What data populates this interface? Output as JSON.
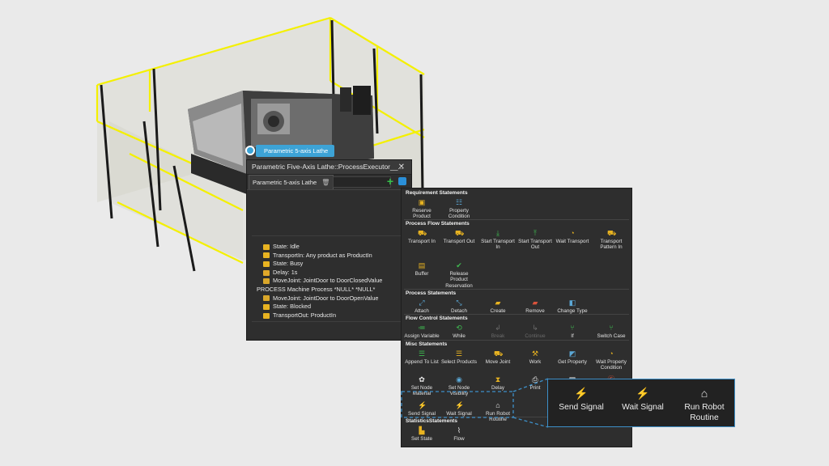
{
  "colors": {
    "accent": "#3d8fc8",
    "fence": "#f4f000",
    "panel_bg": "#2e2e2e",
    "green_plus": "#36c24b"
  },
  "scene": {
    "tooltip_label": "Parametric 5-axis Lathe"
  },
  "executor": {
    "title": "Parametric Five-Axis Lathe::ProcessExecutor__...",
    "close_glyph": "✕",
    "tab_label": "Parametric 5-axis Lathe",
    "add_glyph": "+",
    "statements": [
      {
        "text": "State: Idle",
        "icon": "chart-icon",
        "color": "#e8b321"
      },
      {
        "text": "TransportIn: Any product as ProductIn",
        "icon": "transport-in-icon",
        "color": "#e8b321"
      },
      {
        "text": "State: Busy",
        "icon": "chart-icon",
        "color": "#e8b321"
      },
      {
        "text": "Delay: 1s",
        "icon": "delay-icon",
        "color": "#e0a82a"
      },
      {
        "text": "MoveJoint: JointDoor to DoorClosedValue",
        "icon": "move-joint-icon",
        "color": "#d9a62a"
      },
      {
        "text": "PROCESS Machine Process *NULL* *NULL*",
        "icon": "",
        "color": ""
      },
      {
        "text": "MoveJoint: JointDoor to DoorOpenValue",
        "icon": "move-joint-icon",
        "color": "#d9a62a"
      },
      {
        "text": "State: Blocked",
        "icon": "chart-icon",
        "color": "#e8b321"
      },
      {
        "text": "TransportOut: ProductIn",
        "icon": "transport-out-icon",
        "color": "#e8b321"
      }
    ]
  },
  "palette": {
    "sections": [
      {
        "title": "Requirement Statements",
        "items": [
          {
            "label": "Reserve\nProduct",
            "icon": "reserve-product-icon",
            "glyph": "▣",
            "color": "#e8b321",
            "enabled": true
          },
          {
            "label": "Property\nCondition",
            "icon": "property-condition-icon",
            "glyph": "☷",
            "color": "#5ba8d6",
            "enabled": true
          }
        ]
      },
      {
        "title": "Process Flow Statements",
        "items": [
          {
            "label": "Transport In",
            "icon": "transport-in-icon",
            "glyph": "⛟",
            "color": "#e8b321",
            "enabled": true
          },
          {
            "label": "Transport Out",
            "icon": "transport-out-icon",
            "glyph": "⛟",
            "color": "#e8b321",
            "enabled": true
          },
          {
            "label": "Start Transport\nIn",
            "icon": "start-transport-in-icon",
            "glyph": "⤓",
            "color": "#3fb950",
            "enabled": true
          },
          {
            "label": "Start Transport\nOut",
            "icon": "start-transport-out-icon",
            "glyph": "⤒",
            "color": "#3fb950",
            "enabled": true
          },
          {
            "label": "Wait Transport",
            "icon": "wait-transport-icon",
            "glyph": "◔",
            "color": "#e8b321",
            "enabled": true
          },
          {
            "label": "Transport\nPattern In",
            "icon": "transport-pattern-icon",
            "glyph": "⛟",
            "color": "#e8b321",
            "enabled": true
          },
          {
            "label": "Buffer",
            "icon": "buffer-icon",
            "glyph": "▤",
            "color": "#e8b321",
            "enabled": true
          },
          {
            "label": "Release\nProduct\nReservation",
            "icon": "release-product-icon",
            "glyph": "✔",
            "color": "#3fb950",
            "enabled": true
          }
        ]
      },
      {
        "title": "Process Statements",
        "items": [
          {
            "label": "Attach",
            "icon": "attach-icon",
            "glyph": "⤢",
            "color": "#5ba8d6",
            "enabled": true
          },
          {
            "label": "Detach",
            "icon": "detach-icon",
            "glyph": "⤡",
            "color": "#5ba8d6",
            "enabled": true
          },
          {
            "label": "Create",
            "icon": "create-icon",
            "glyph": "▰",
            "color": "#e8b321",
            "enabled": true
          },
          {
            "label": "Remove",
            "icon": "remove-icon",
            "glyph": "▰",
            "color": "#d9533c",
            "enabled": true
          },
          {
            "label": "Change Type",
            "icon": "change-type-icon",
            "glyph": "◧",
            "color": "#5ba8d6",
            "enabled": true
          }
        ]
      },
      {
        "title": "Flow Control Statements",
        "items": [
          {
            "label": "Assign Variable",
            "icon": "assign-variable-icon",
            "glyph": "≔",
            "color": "#3fb950",
            "enabled": true
          },
          {
            "label": "While",
            "icon": "while-icon",
            "glyph": "⟲",
            "color": "#3fb950",
            "enabled": true
          },
          {
            "label": "Break",
            "icon": "break-icon",
            "glyph": "↲",
            "color": "#6b6b6b",
            "enabled": false
          },
          {
            "label": "Continue",
            "icon": "continue-icon",
            "glyph": "↳",
            "color": "#6b6b6b",
            "enabled": false
          },
          {
            "label": "If",
            "icon": "if-icon",
            "glyph": "⑂",
            "color": "#3fb950",
            "enabled": true
          },
          {
            "label": "Switch Case",
            "icon": "switch-case-icon",
            "glyph": "⑂",
            "color": "#3fb950",
            "enabled": true
          }
        ]
      },
      {
        "title": "Misc Statements",
        "items": [
          {
            "label": "Append To List",
            "icon": "append-list-icon",
            "glyph": "☰",
            "color": "#3fb950",
            "enabled": true
          },
          {
            "label": "Select Products",
            "icon": "select-products-icon",
            "glyph": "☰",
            "color": "#e8b321",
            "enabled": true
          },
          {
            "label": "Move Joint",
            "icon": "move-joint-icon",
            "glyph": "⛟",
            "color": "#e8b321",
            "enabled": true
          },
          {
            "label": "Work",
            "icon": "work-icon",
            "glyph": "⚒",
            "color": "#e8b321",
            "enabled": true
          },
          {
            "label": "Get Property",
            "icon": "get-property-icon",
            "glyph": "◩",
            "color": "#5ba8d6",
            "enabled": true
          },
          {
            "label": "Wait Property\nCondition",
            "icon": "wait-property-icon",
            "glyph": "◔",
            "color": "#e8b321",
            "enabled": true
          },
          {
            "label": "Set Node\nMaterial",
            "icon": "set-material-icon",
            "glyph": "✿",
            "color": "#e8e8e8",
            "enabled": true
          },
          {
            "label": "Set Node\nVisibility",
            "icon": "set-visibility-icon",
            "glyph": "◉",
            "color": "#5ba8d6",
            "enabled": true
          },
          {
            "label": "Delay",
            "icon": "delay-icon",
            "glyph": "⧗",
            "color": "#e8b321",
            "enabled": true
          },
          {
            "label": "Print",
            "icon": "print-icon",
            "glyph": "⎙",
            "color": "#e8e8e8",
            "enabled": true
          },
          {
            "label": "",
            "icon": "document-icon",
            "glyph": "▤",
            "color": "#e8e8e8",
            "enabled": true
          },
          {
            "label": "",
            "icon": "script-icon",
            "glyph": "Ⓢ",
            "color": "#d9533c",
            "enabled": true
          },
          {
            "label": "Send Signal",
            "icon": "send-signal-icon",
            "glyph": "⚡",
            "color": "#e8b321",
            "enabled": true
          },
          {
            "label": "Wait Signal",
            "icon": "wait-signal-icon",
            "glyph": "⚡",
            "color": "#e8b321",
            "enabled": true
          },
          {
            "label": "Run Robot\nRoutine",
            "icon": "run-robot-icon",
            "glyph": "⌂",
            "color": "#e8e8e8",
            "enabled": true
          }
        ]
      },
      {
        "title": "StatisticsStatements",
        "items": [
          {
            "label": "Set State",
            "icon": "set-state-icon",
            "glyph": "▙",
            "color": "#e8b321",
            "enabled": true
          },
          {
            "label": "Flow",
            "icon": "flow-icon",
            "glyph": "⌇",
            "color": "#e8e8e8",
            "enabled": true
          }
        ]
      }
    ]
  },
  "zoom": {
    "items": [
      {
        "label": "Send Signal",
        "icon": "send-signal-icon",
        "glyph": "⚡",
        "color": "#e8b321"
      },
      {
        "label": "Wait Signal",
        "icon": "wait-signal-icon",
        "glyph": "⚡",
        "color": "#e8b321"
      },
      {
        "label": "Run Robot\nRoutine",
        "icon": "run-robot-icon",
        "glyph": "⌂",
        "color": "#e8e8e8"
      }
    ]
  }
}
